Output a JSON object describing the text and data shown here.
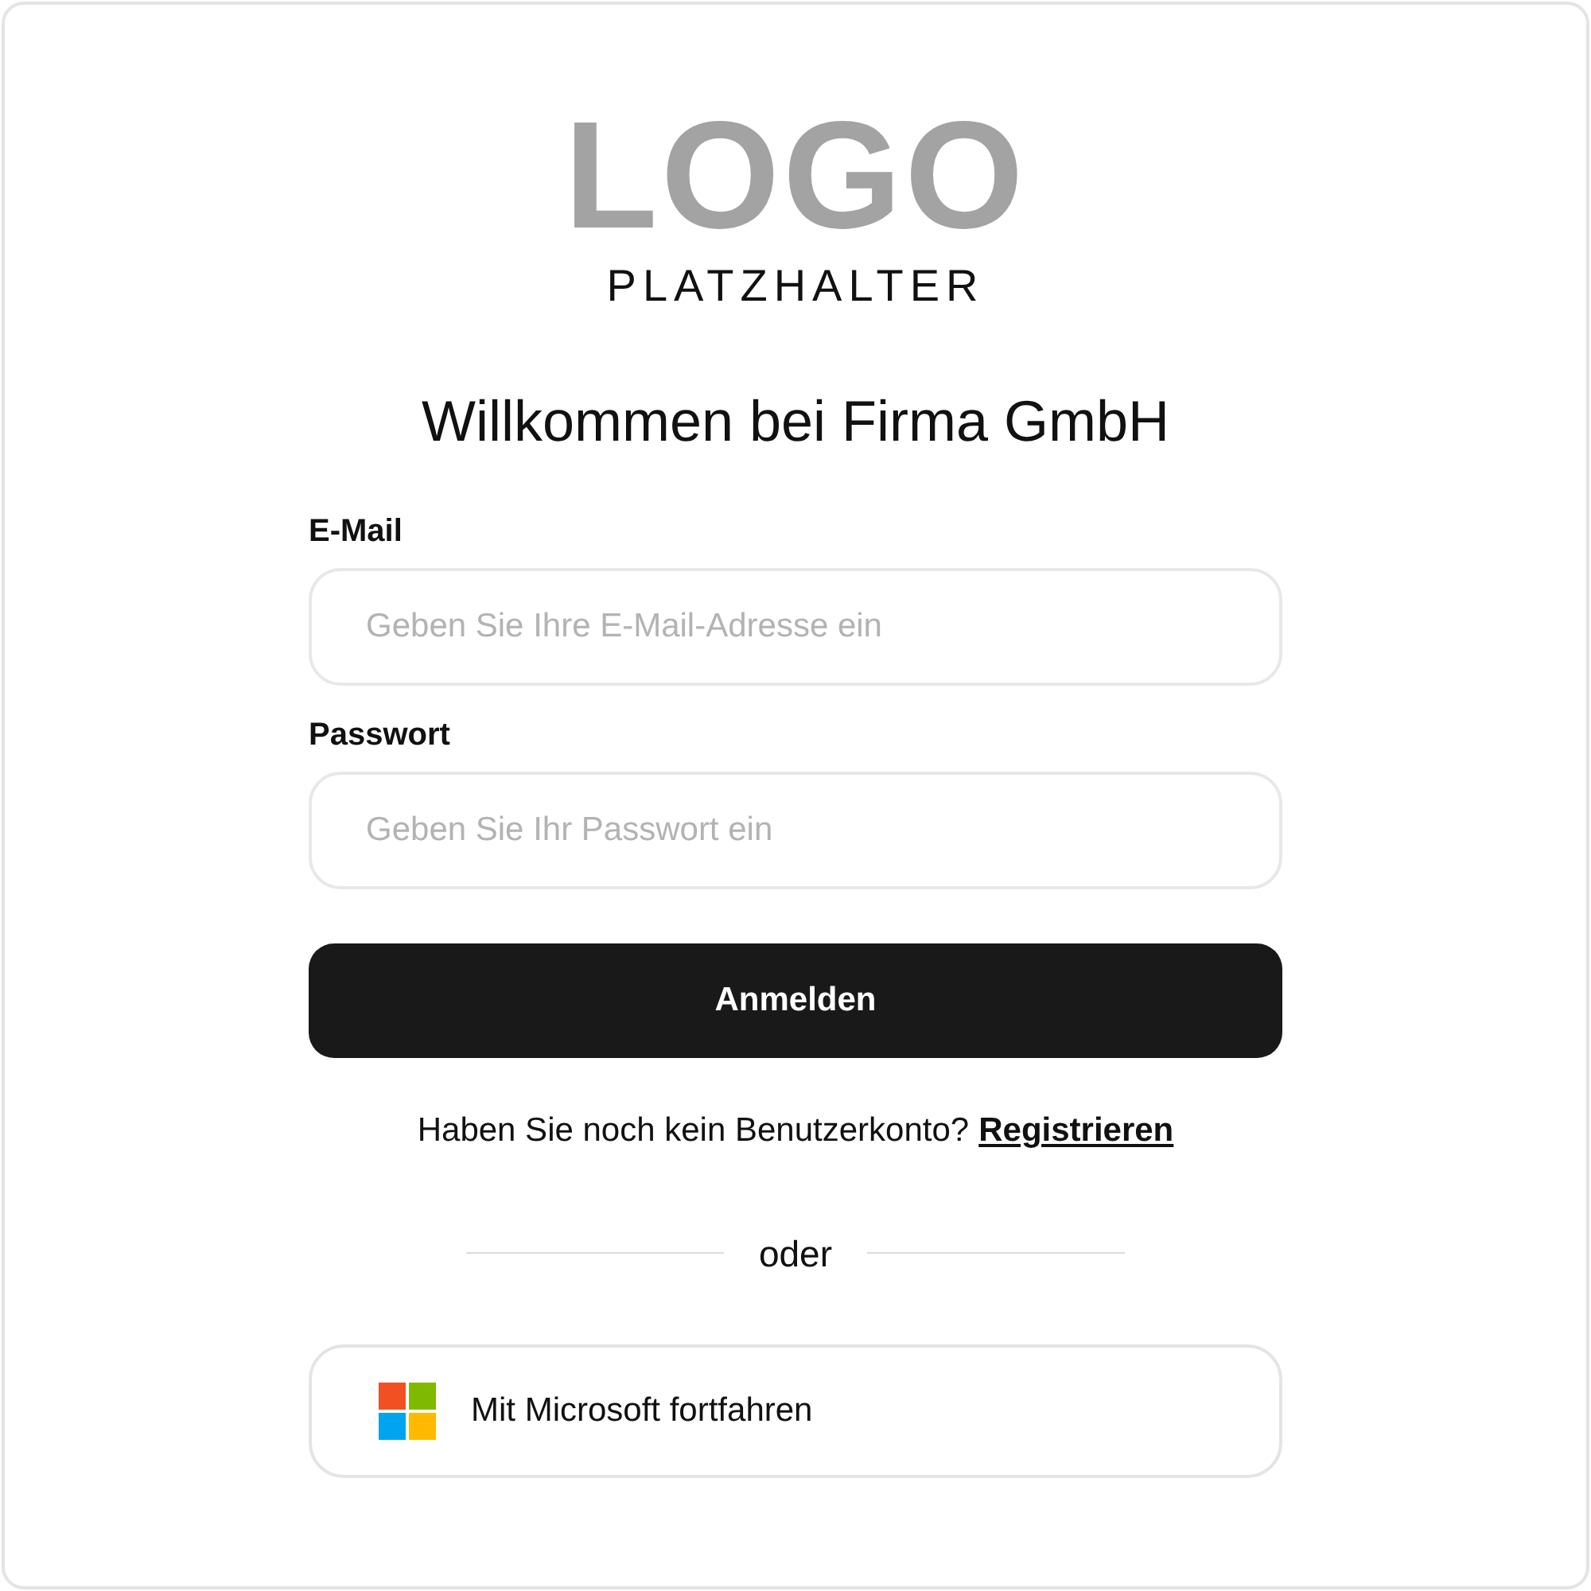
{
  "logo": {
    "mark": "LOGO",
    "subtitle": "PLATZHALTER"
  },
  "title": "Willkommen bei Firma GmbH",
  "fields": [
    {
      "label": "E-Mail",
      "placeholder": "Geben Sie Ihre E-Mail-Adresse ein"
    },
    {
      "label": "Passwort",
      "placeholder": "Geben Sie Ihr Passwort ein"
    }
  ],
  "submit": "Anmelden",
  "register": {
    "text": "Haben Sie noch kein Benutzerkonto?",
    "link": "Registrieren"
  },
  "divider": "oder",
  "sso_button": "Mit Microsoft fortfahren"
}
